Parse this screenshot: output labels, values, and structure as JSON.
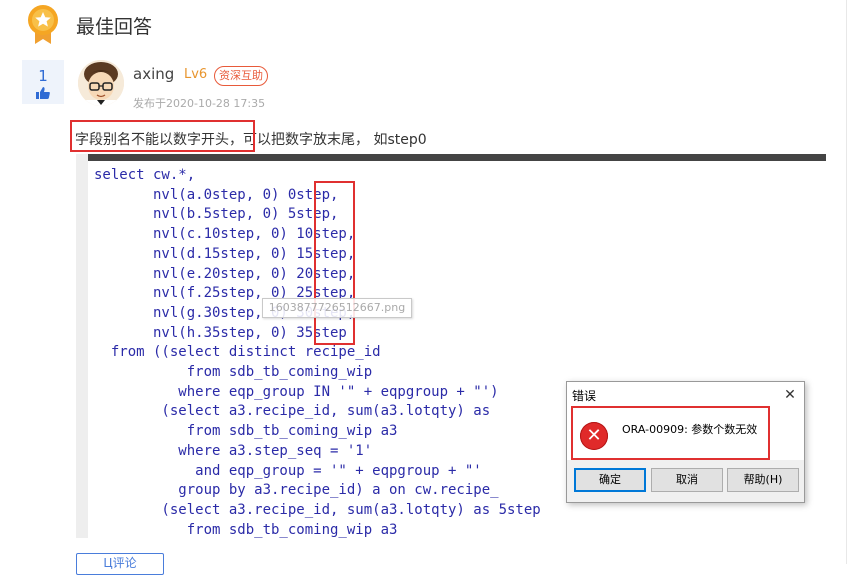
{
  "header": {
    "title": "最佳回答"
  },
  "answer": {
    "votes": "1",
    "username": "axing",
    "level": "Lv6",
    "badge": "资深互助",
    "post_time": "发布于2020-10-28 17:35",
    "text_highlight": "字段别名不能以数字开头",
    "text_rest": "，可以把数字放末尾， 如step0"
  },
  "code": {
    "lines": [
      "select cw.*,",
      "       nvl(a.0step, 0) 0step,",
      "       nvl(b.5step, 0) 5step,",
      "       nvl(c.10step, 0) 10step,",
      "       nvl(d.15step, 0) 15step,",
      "       nvl(e.20step, 0) 20step,",
      "       nvl(f.25step, 0) 25step,",
      "       nvl(g.30step, 0) 30step,",
      "       nvl(h.35step, 0) 35step",
      "  from ((select distinct recipe_id",
      "           from sdb_tb_coming_wip",
      "          where eqp_group IN '\" + eqpgroup + \"')",
      "        (select a3.recipe_id, sum(a3.lotqty) as",
      "           from sdb_tb_coming_wip a3",
      "          where a3.step_seq = '1'",
      "            and eqp_group = '\" + eqpgroup + \"'",
      "          group by a3.recipe_id) a on cw.recipe_                  in",
      "        (select a3.recipe_id, sum(a3.lotqty) as 5step",
      "           from sdb_tb_coming_wip a3"
    ],
    "image_tag": "1603877726512667.png"
  },
  "dialog": {
    "title": "错误",
    "close": "✕",
    "message": "ORA-00909: 参数个数无效",
    "buttons": {
      "ok": "确定",
      "cancel": "取消",
      "help": "帮助(H)"
    }
  },
  "footer": {
    "comment_button": "Ц评论"
  },
  "colors": {
    "highlight_red": "#e03030",
    "link_blue": "#4a7ddb",
    "code_blue": "#2b2ba8",
    "medal_orange": "#f5a623"
  }
}
